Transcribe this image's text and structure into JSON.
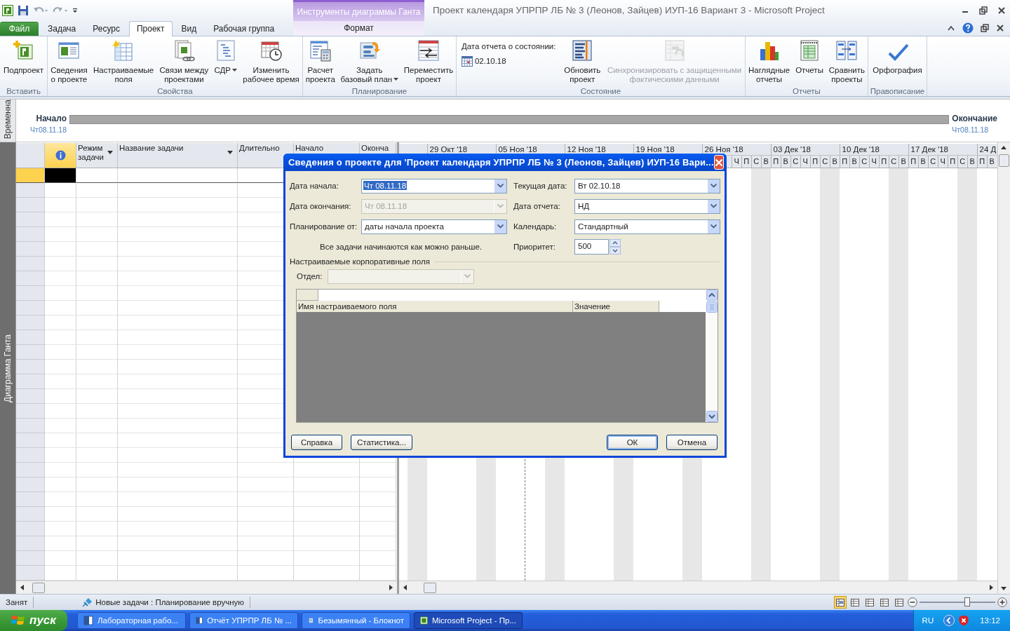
{
  "window": {
    "title": "Проект календаря УПРПР ЛБ № 3 (Леонов, Зайцев) ИУП-16 Вариант 3  -  Microsoft Project",
    "contextual_group": "Инструменты диаграммы Ганта"
  },
  "tabs": [
    {
      "label": "Файл",
      "kind": "file",
      "selected": false
    },
    {
      "label": "Задача",
      "kind": "normal",
      "selected": false
    },
    {
      "label": "Ресурс",
      "kind": "normal",
      "selected": false
    },
    {
      "label": "Проект",
      "kind": "normal",
      "selected": true
    },
    {
      "label": "Вид",
      "kind": "normal",
      "selected": false
    },
    {
      "label": "Рабочая группа",
      "kind": "normal",
      "selected": false
    },
    {
      "label": "Формат",
      "kind": "contextual",
      "selected": false
    }
  ],
  "ribbon_groups": [
    {
      "label": "Вставить",
      "items": [
        {
          "kind": "large",
          "label": "Подпроект",
          "dropdown": false,
          "disabled": false
        }
      ]
    },
    {
      "label": "Свойства",
      "items": [
        {
          "kind": "large",
          "label": "Сведения\nо проекте",
          "dropdown": false,
          "disabled": false
        },
        {
          "kind": "large",
          "label": "Настраиваемые\nполя",
          "dropdown": false,
          "disabled": false
        },
        {
          "kind": "large",
          "label": "Связи между\nпроектами",
          "dropdown": false,
          "disabled": false
        },
        {
          "kind": "large",
          "label": "СДР",
          "dropdown": true,
          "disabled": false
        },
        {
          "kind": "large",
          "label": "Изменить\nрабочее время",
          "dropdown": false,
          "disabled": false
        }
      ]
    },
    {
      "label": "Планирование",
      "items": [
        {
          "kind": "large",
          "label": "Расчет\nпроекта",
          "dropdown": false,
          "disabled": false
        },
        {
          "kind": "large",
          "label": "Задать\nбазовый план",
          "dropdown": true,
          "disabled": false
        },
        {
          "kind": "large",
          "label": "Переместить\nпроект",
          "dropdown": false,
          "disabled": false
        }
      ]
    },
    {
      "label": "Состояние",
      "items": [
        {
          "kind": "status_date",
          "label": "Дата отчета о состоянии:",
          "value": "02.10.18"
        },
        {
          "kind": "large",
          "label": "Обновить\nпроект",
          "dropdown": false,
          "disabled": false
        },
        {
          "kind": "large",
          "label": "Синхронизировать с защищенными\nфактическими данными",
          "dropdown": false,
          "disabled": true
        }
      ]
    },
    {
      "label": "Отчеты",
      "items": [
        {
          "kind": "large",
          "label": "Наглядные\nотчеты",
          "dropdown": false,
          "disabled": false
        },
        {
          "kind": "large",
          "label": "Отчеты",
          "dropdown": false,
          "disabled": false
        },
        {
          "kind": "large",
          "label": "Сравнить\nпроекты",
          "dropdown": false,
          "disabled": false
        }
      ]
    },
    {
      "label": "Правописание",
      "items": [
        {
          "kind": "large",
          "label": "Орфография",
          "dropdown": false,
          "disabled": false
        }
      ]
    }
  ],
  "timeline": {
    "side_label": "Временна",
    "start_label": "Начало",
    "start_date": "Чт08.11.18",
    "end_label": "Окончание",
    "end_date": "Чт08.11.18"
  },
  "gantt": {
    "side_label": "Диаграмма Ганта",
    "columns": [
      {
        "label": "Режим\nзадачи",
        "dropdown": true
      },
      {
        "label": "Название задачи",
        "dropdown": true
      },
      {
        "label": "Длительно",
        "dropdown": false
      },
      {
        "label": "Начало",
        "dropdown": false
      },
      {
        "label": "Оконча",
        "dropdown": false
      }
    ],
    "weeks": [
      "29 Окт '18",
      "05 Ноя '18",
      "12 Ноя '18",
      "19 Ноя '18",
      "26 Ноя '18",
      "03 Дек '18",
      "10 Дек '18",
      "17 Дек '18",
      "24 Д"
    ],
    "days": [
      "Ч",
      "П",
      "С",
      "В",
      "П",
      "В",
      "С",
      "Ч",
      "П",
      "С",
      "В",
      "П",
      "В",
      "С",
      "Ч",
      "П",
      "С",
      "В",
      "П",
      "В",
      "С",
      "Ч",
      "П",
      "С",
      "В",
      "П",
      "В"
    ]
  },
  "dialog": {
    "title": "Сведения о проекте для 'Проект календаря УПРПР ЛБ № 3 (Леонов, Зайцев) ИУП-16 Вари...",
    "left_fields": [
      {
        "label": "Дата начала:",
        "value": "Чт 08.11.18",
        "disabled": false,
        "highlighted": true
      },
      {
        "label": "Дата окончания:",
        "value": "Чт 08.11.18",
        "disabled": true,
        "highlighted": false
      },
      {
        "label": "Планирование от:",
        "value": "даты начала проекта",
        "disabled": false,
        "highlighted": false
      }
    ],
    "right_fields": [
      {
        "label": "Текущая дата:",
        "value": "Вт 02.10.18",
        "kind": "combo"
      },
      {
        "label": "Дата отчета:",
        "value": "НД",
        "kind": "combo"
      },
      {
        "label": "Календарь:",
        "value": "Стандартный",
        "kind": "combo"
      },
      {
        "label": "Приоритет:",
        "value": "500",
        "kind": "spinner"
      }
    ],
    "note": "Все задачи начинаются как можно раньше.",
    "section": "Настраиваемые корпоративные поля",
    "department": {
      "label": "Отдел:",
      "disabled": true
    },
    "grid_columns": [
      "Имя настраиваемого поля",
      "Значение"
    ],
    "buttons": [
      {
        "label": "Справка",
        "default": false
      },
      {
        "label": "Статистика...",
        "default": false
      },
      {
        "label": "ОК",
        "default": true
      },
      {
        "label": "Отмена",
        "default": false
      }
    ]
  },
  "status_bar": {
    "mode": "Занят",
    "new_tasks": "Новые задачи : Планирование вручную",
    "views": [
      {
        "selected": true
      },
      {
        "selected": false
      },
      {
        "selected": false
      },
      {
        "selected": false
      },
      {
        "selected": false
      }
    ],
    "zoom": {
      "level": 0.63
    }
  },
  "taskbar": {
    "start": "пуск",
    "tasks": [
      {
        "label": "Лабораторная рабо...",
        "selected": false
      },
      {
        "label": "Отчёт УПРПР ЛБ № ...",
        "selected": false
      },
      {
        "label": "Безымянный - Блокнот",
        "selected": false
      },
      {
        "label": "Microsoft Project - Пр...",
        "selected": true
      }
    ],
    "language": "RU",
    "clock": "13:12"
  }
}
